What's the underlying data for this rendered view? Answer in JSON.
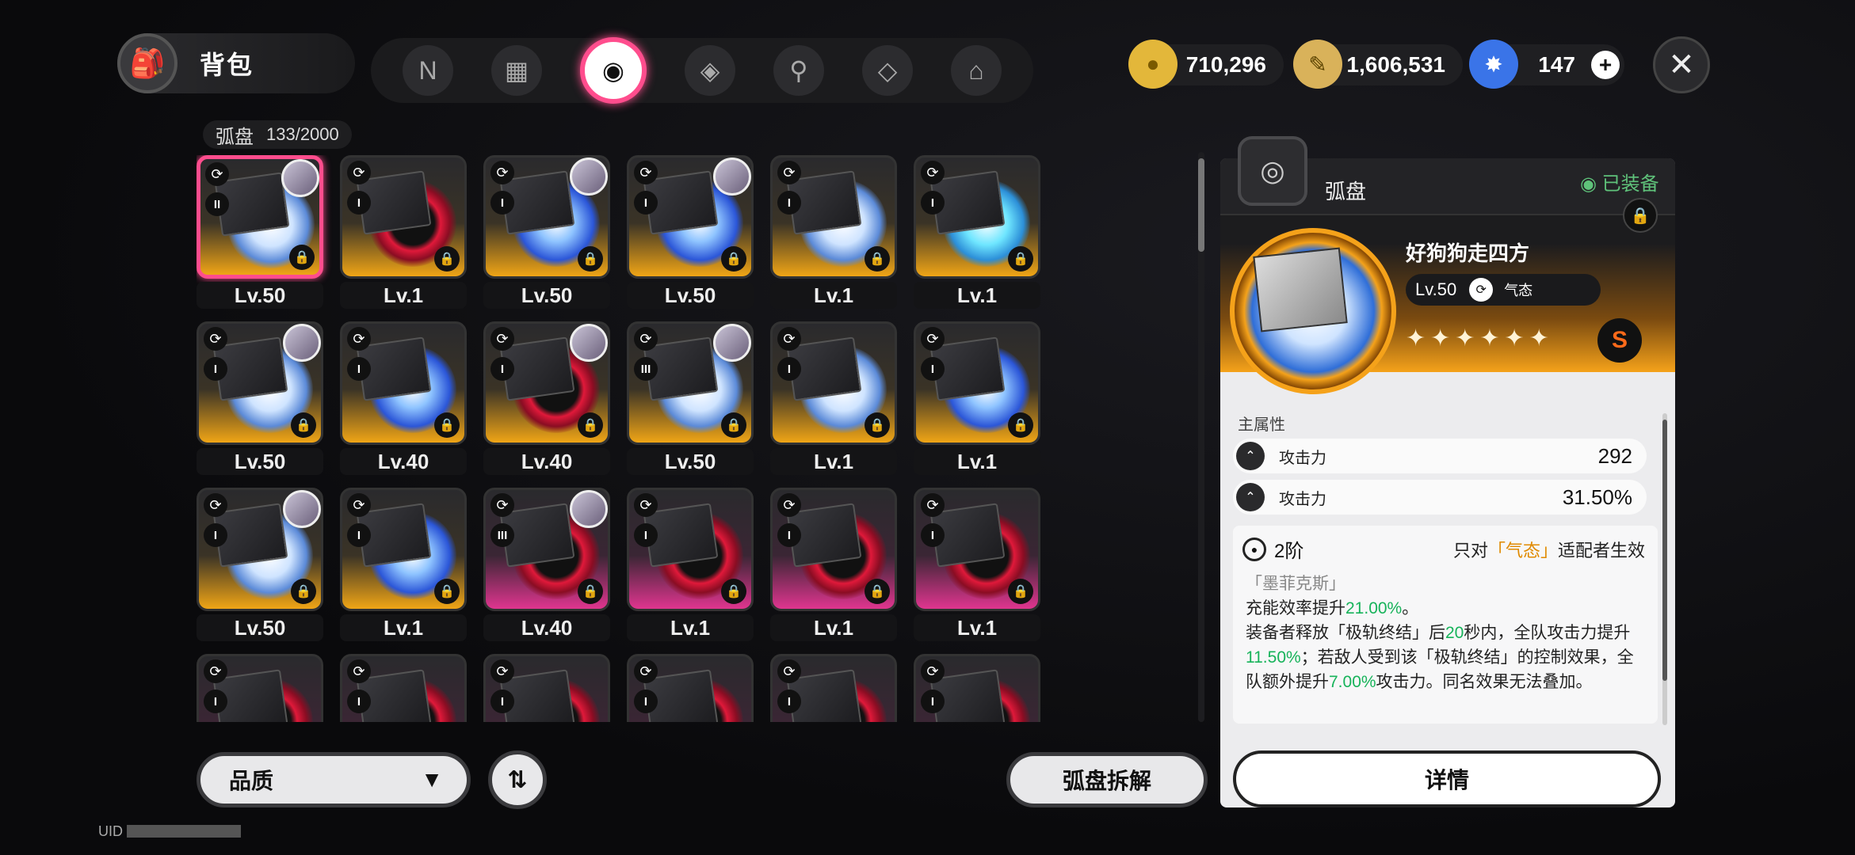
{
  "header": {
    "bag_label": "背包",
    "tabs": [
      {
        "icon": "N",
        "name": "tab-n"
      },
      {
        "icon": "▦",
        "name": "tab-device"
      },
      {
        "icon": "◉",
        "name": "tab-disc",
        "active": true
      },
      {
        "icon": "◈",
        "name": "tab-box"
      },
      {
        "icon": "⚲",
        "name": "tab-food"
      },
      {
        "icon": "◇",
        "name": "tab-crystal"
      },
      {
        "icon": "⌂",
        "name": "tab-home"
      }
    ],
    "currencies": [
      {
        "value": "710,296",
        "icon": "coin-icon",
        "color": "#e3b73a"
      },
      {
        "value": "1,606,531",
        "icon": "ticket-icon",
        "color": "#d9b25a"
      },
      {
        "value": "147",
        "icon": "crystal-icon",
        "color": "#3a74e8"
      }
    ]
  },
  "inventory": {
    "category": "弧盘",
    "count": "133/2000"
  },
  "cards": [
    {
      "level": "Lv.50",
      "tier": "II",
      "rarity": "gold",
      "disc": "white",
      "avatar": true,
      "selected": true
    },
    {
      "level": "Lv.1",
      "tier": "I",
      "rarity": "gold",
      "disc": "red",
      "avatar": false
    },
    {
      "level": "Lv.50",
      "tier": "I",
      "rarity": "gold",
      "disc": "blue",
      "avatar": true
    },
    {
      "level": "Lv.50",
      "tier": "I",
      "rarity": "gold",
      "disc": "blue",
      "avatar": true
    },
    {
      "level": "Lv.1",
      "tier": "I",
      "rarity": "gold",
      "disc": "white",
      "avatar": false
    },
    {
      "level": "Lv.1",
      "tier": "I",
      "rarity": "gold",
      "disc": "cyan",
      "avatar": false
    },
    {
      "level": "Lv.50",
      "tier": "I",
      "rarity": "gold",
      "disc": "white",
      "avatar": true
    },
    {
      "level": "Lv.40",
      "tier": "I",
      "rarity": "gold",
      "disc": "blue",
      "avatar": false
    },
    {
      "level": "Lv.40",
      "tier": "I",
      "rarity": "gold",
      "disc": "red",
      "avatar": true
    },
    {
      "level": "Lv.50",
      "tier": "III",
      "rarity": "gold",
      "disc": "white",
      "avatar": true
    },
    {
      "level": "Lv.1",
      "tier": "I",
      "rarity": "gold",
      "disc": "white",
      "avatar": false
    },
    {
      "level": "Lv.1",
      "tier": "I",
      "rarity": "gold",
      "disc": "blue",
      "avatar": false
    },
    {
      "level": "Lv.50",
      "tier": "I",
      "rarity": "gold",
      "disc": "white",
      "avatar": true
    },
    {
      "level": "Lv.1",
      "tier": "I",
      "rarity": "gold",
      "disc": "blue",
      "avatar": false
    },
    {
      "level": "Lv.40",
      "tier": "III",
      "rarity": "purple",
      "disc": "red",
      "avatar": true
    },
    {
      "level": "Lv.1",
      "tier": "I",
      "rarity": "purple",
      "disc": "red",
      "avatar": false
    },
    {
      "level": "Lv.1",
      "tier": "I",
      "rarity": "purple",
      "disc": "red",
      "avatar": false
    },
    {
      "level": "Lv.1",
      "tier": "I",
      "rarity": "purple",
      "disc": "red",
      "avatar": false
    },
    {
      "level": "",
      "tier": "I",
      "rarity": "purple",
      "disc": "red",
      "avatar": false
    },
    {
      "level": "",
      "tier": "I",
      "rarity": "purple",
      "disc": "red",
      "avatar": false
    },
    {
      "level": "",
      "tier": "I",
      "rarity": "purple",
      "disc": "red",
      "avatar": false
    },
    {
      "level": "",
      "tier": "I",
      "rarity": "purple",
      "disc": "red",
      "avatar": false
    },
    {
      "level": "",
      "tier": "I",
      "rarity": "purple",
      "disc": "red",
      "avatar": false
    },
    {
      "level": "",
      "tier": "I",
      "rarity": "purple",
      "disc": "red",
      "avatar": false
    }
  ],
  "controls": {
    "quality_label": "品质",
    "dismantle_label": "弧盘拆解",
    "details_label": "详情"
  },
  "detail": {
    "category": "弧盘",
    "equipped": "已装备",
    "name": "好狗狗走四方",
    "level": "Lv.50",
    "attribute": "气态",
    "stars": "✦✦✦✦✦✦",
    "rank": "S",
    "main_attr_title": "主属性",
    "stats": [
      {
        "label": "攻击力",
        "value": "292"
      },
      {
        "label": "攻击力",
        "value": "31.50%"
      }
    ],
    "set_tier": "2阶",
    "set_cond_prefix": "只对",
    "set_cond_attr": "「气态」",
    "set_cond_suffix": "适配者生效",
    "set_name": "「墨菲克斯」",
    "line1_a": "充能效率提升",
    "line1_v": "21.00%",
    "line1_b": "。",
    "line2_a": "装备者释放「极轨终结」后",
    "line2_v": "20",
    "line2_b": "秒内，全队攻击力提升",
    "line2_v2": "11.50%",
    "line2_c": "；若敌人受到该「极轨终结」的控制效果，全队额外提升",
    "line2_v3": "7.00%",
    "line2_d": "攻击力。同名效果无法叠加。"
  },
  "footer": {
    "uid_label": "UID"
  }
}
